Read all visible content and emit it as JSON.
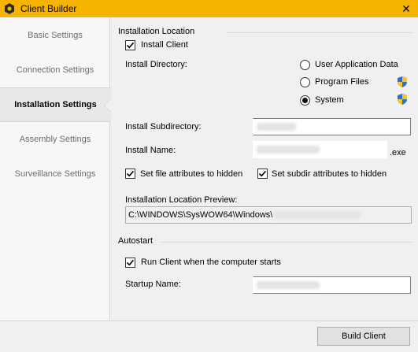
{
  "window": {
    "title": "Client Builder",
    "close_glyph": "✕",
    "title_bar_color": "#f4b400"
  },
  "sidebar": {
    "items": [
      {
        "label": "Basic Settings",
        "active": false
      },
      {
        "label": "Connection Settings",
        "active": false
      },
      {
        "label": "Installation Settings",
        "active": true
      },
      {
        "label": "Assembly Settings",
        "active": false
      },
      {
        "label": "Surveillance Settings",
        "active": false
      }
    ]
  },
  "installation": {
    "group_title": "Installation Location",
    "install_client_label": "Install Client",
    "install_client_checked": true,
    "install_directory_label": "Install Directory:",
    "directory_options": [
      {
        "label": "User Application Data",
        "selected": false,
        "shield": false
      },
      {
        "label": "Program Files",
        "selected": false,
        "shield": true
      },
      {
        "label": "System",
        "selected": true,
        "shield": true
      }
    ],
    "subdirectory_label": "Install Subdirectory:",
    "install_name_label": "Install Name:",
    "exe_suffix": ".exe",
    "hidden_file_label": "Set file attributes to hidden",
    "hidden_file_checked": true,
    "hidden_subdir_label": "Set subdir attributes to hidden",
    "hidden_subdir_checked": true,
    "preview_label": "Installation Location Preview:",
    "preview_value": "C:\\WINDOWS\\SysWOW64\\Windows\\"
  },
  "autostart": {
    "group_title": "Autostart",
    "run_on_start_label": "Run Client when the computer starts",
    "run_on_start_checked": true,
    "startup_name_label": "Startup Name:"
  },
  "footer": {
    "build_button_label": "Build Client"
  }
}
